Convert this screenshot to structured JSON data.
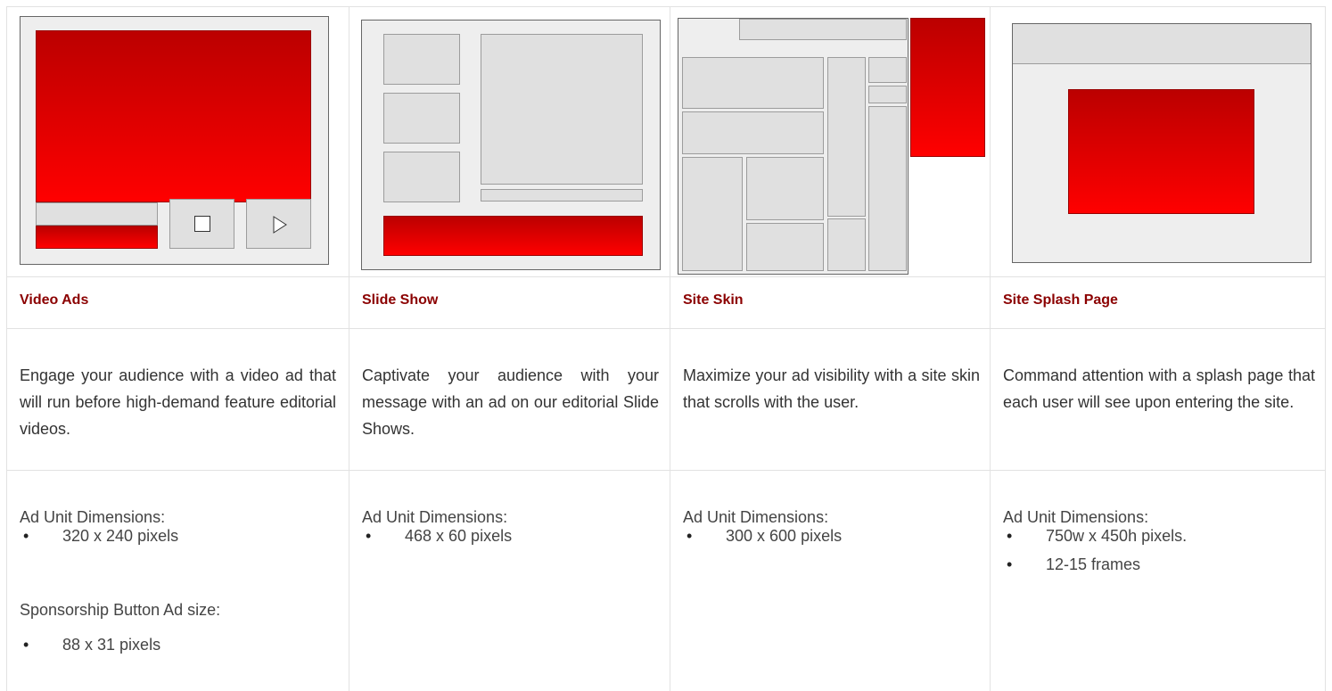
{
  "columns": [
    {
      "title": "Video Ads",
      "description": "Engage your audience with a video ad that will run before high-demand feature editorial videos.",
      "spec_groups": [
        {
          "label": "Ad Unit Dimensions:",
          "items": [
            "320 x 240 pixels"
          ]
        },
        {
          "label": "Sponsorship Button Ad size:",
          "items": [
            "88 x 31 pixels"
          ]
        }
      ],
      "thumbnail_icon": "video-player-icon"
    },
    {
      "title": "Slide Show",
      "description": "Captivate your audience with your message with an ad on our editorial Slide Shows.",
      "spec_groups": [
        {
          "label": "Ad Unit Dimensions:",
          "items": [
            "468 x 60 pixels"
          ]
        }
      ],
      "thumbnail_icon": "slideshow-layout-icon"
    },
    {
      "title": "Site Skin",
      "description": "Maximize your ad visibility with a site skin that scrolls with the user.",
      "spec_groups": [
        {
          "label": "Ad Unit Dimensions:",
          "items": [
            "300 x 600 pixels"
          ]
        }
      ],
      "thumbnail_icon": "site-skin-layout-icon"
    },
    {
      "title": "Site Splash Page",
      "description": "Command attention with a splash page that each user will see upon entering the site.",
      "spec_groups": [
        {
          "label": "Ad Unit Dimensions:",
          "items": [
            "750w x 450h pixels.",
            "12-15 frames"
          ]
        }
      ],
      "thumbnail_icon": "splash-page-layout-icon"
    }
  ],
  "colors": {
    "title": "#8b0000",
    "ad_red_top": "#bb0000",
    "ad_red_bottom": "#ff0000",
    "placeholder_gray": "#e0e0e0",
    "border": "#e2e2e2"
  }
}
